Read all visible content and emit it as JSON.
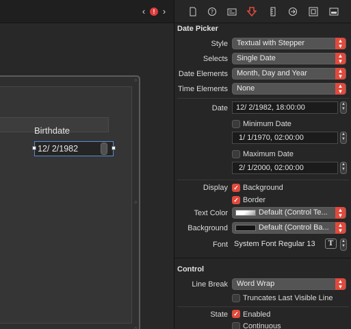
{
  "canvas": {
    "nav_back": "‹",
    "nav_forward": "›",
    "issue_badge": "!",
    "birthdate_label": "Birthdate",
    "date_value": "12/  2/1982"
  },
  "inspector": {
    "toolbar_icons": [
      "file-icon",
      "help-icon",
      "identity-icon",
      "attributes-icon",
      "ruler-icon",
      "connections-icon",
      "bindings-icon",
      "effects-icon"
    ],
    "date_picker": {
      "title": "Date Picker",
      "style_label": "Style",
      "style_value": "Textual with Stepper",
      "selects_label": "Selects",
      "selects_value": "Single Date",
      "elements_label": "Date Elements",
      "elements_value": "Month, Day and Year",
      "time_label": "Time Elements",
      "time_value": "None",
      "date_label": "Date",
      "date_value": "12/  2/1982, 18:00:00",
      "min_label": "Minimum Date",
      "min_value": "1/  1/1970, 02:00:00",
      "max_label": "Maximum Date",
      "max_value": "2/  1/2000, 02:00:00",
      "display_label": "Display",
      "background_cb": "Background",
      "border_cb": "Border",
      "text_color_label": "Text Color",
      "text_color_value": "Default (Control Te...",
      "background_label": "Background",
      "background_value": "Default (Control Ba...",
      "font_label": "Font",
      "font_value": "System Font Regular 13",
      "font_icon": "T"
    },
    "control": {
      "title": "Control",
      "line_break_label": "Line Break",
      "line_break_value": "Word Wrap",
      "truncates_cb": "Truncates Last Visible Line",
      "state_label": "State",
      "enabled_cb": "Enabled",
      "continuous_cb": "Continuous"
    }
  },
  "colors": {
    "accent": "#e04a3c",
    "panel_bg": "#262626",
    "canvas_bg": "#2c2c2c"
  }
}
